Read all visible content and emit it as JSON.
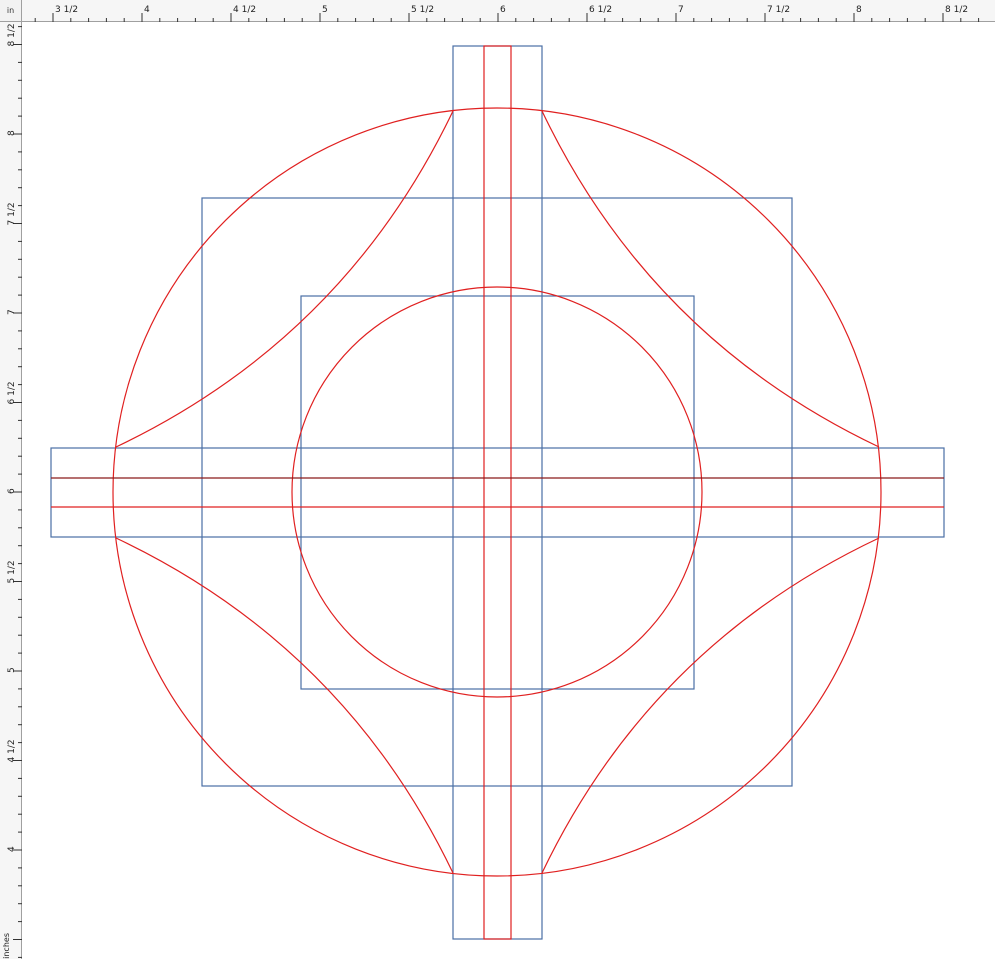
{
  "rulers": {
    "horizontal": [
      {
        "label": "3  1/2",
        "value": 3.5
      },
      {
        "label": "4",
        "value": 4
      },
      {
        "label": "4  1/2",
        "value": 4.5
      },
      {
        "label": "5",
        "value": 5
      },
      {
        "label": "5  1/2",
        "value": 5.5
      },
      {
        "label": "6",
        "value": 6
      },
      {
        "label": "6  1/2",
        "value": 6.5
      },
      {
        "label": "7",
        "value": 7
      },
      {
        "label": "7  1/2",
        "value": 7.5
      },
      {
        "label": "8",
        "value": 8
      },
      {
        "label": "8  1/2",
        "value": 8.5
      }
    ],
    "vertical": [
      {
        "label": "8  1/2",
        "value": 8.5
      },
      {
        "label": "8",
        "value": 8
      },
      {
        "label": "7  1/2",
        "value": 7.5
      },
      {
        "label": "7",
        "value": 7
      },
      {
        "label": "6  1/2",
        "value": 6.5
      },
      {
        "label": "6",
        "value": 6
      },
      {
        "label": "5  1/2",
        "value": 5.5
      },
      {
        "label": "5",
        "value": 5
      },
      {
        "label": "4  1/2",
        "value": 4.5
      },
      {
        "label": "4",
        "value": 4
      }
    ],
    "corner_label": "in",
    "units_label": "inches"
  },
  "colors": {
    "blue_outline": "#4a6fa5",
    "red_line": "#e02020",
    "dark_red_line": "#8b1a1a",
    "ruler_bg": "#f6f6f6"
  }
}
